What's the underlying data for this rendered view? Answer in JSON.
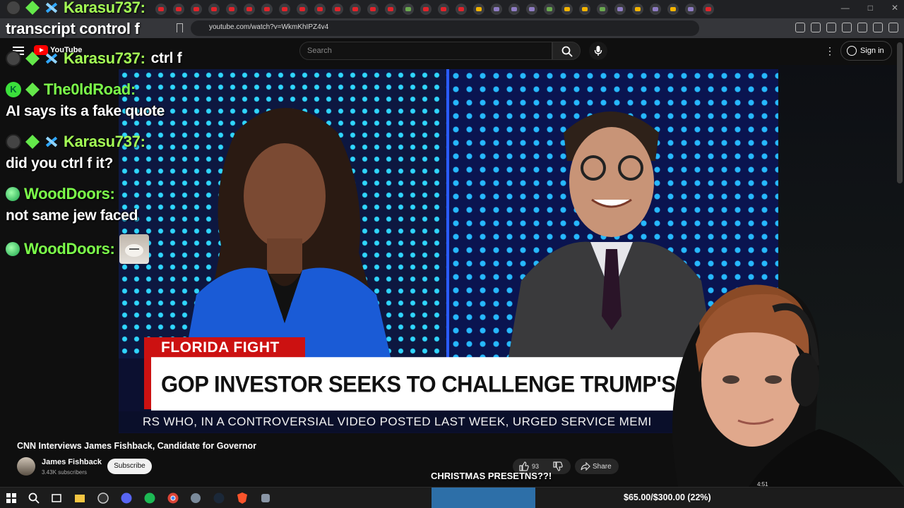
{
  "browser": {
    "url": "youtube.com/watch?v=WkmKhIPZ4v4"
  },
  "youtube": {
    "logo_text": "YouTube",
    "search_placeholder": "Search",
    "sign_in_label": "Sign in"
  },
  "video": {
    "chyron_tag": "FLORIDA FIGHT",
    "chyron_headline": "GOP INVESTOR SEEKS TO CHALLENGE TRUMP'S CHOICE FOR FL GOVERN",
    "ticker": "RS WHO, IN A CONTROVERSIAL VIDEO POSTED LAST WEEK, URGED SERVICE MEMI",
    "title": "CNN Interviews James Fishback, Candidate for Governor",
    "channel_name": "James Fishback",
    "subscribers": "3.43K subscribers",
    "subscribe_label": "Subscribe",
    "like_count": "93",
    "share_label": "Share"
  },
  "overlay": {
    "title_text": "transcript control f",
    "chat": [
      {
        "user": "Karasu737:",
        "message": "ctrl f"
      },
      {
        "user": "The0ldRoad:",
        "message": "AI says its a fake quote"
      },
      {
        "user": "Karasu737:",
        "message": "did you ctrl f it?"
      },
      {
        "user": "WoodDoors:",
        "message": "not same jew faced"
      },
      {
        "user": "WoodDoors:",
        "message": ""
      }
    ],
    "top_user": "Karasu737:",
    "christmas_text": "CHRISTMAS PRESETNS??!",
    "webcam_time": "4:51"
  },
  "goal": {
    "text": "$65.00/$300.00 (22%)",
    "fraction": 0.22
  },
  "colors": {
    "chat_name": "#7cff4a",
    "youtube_red": "#ff0000",
    "cnn_red": "#cc1111",
    "goal_bar": "#2d6fa8"
  }
}
